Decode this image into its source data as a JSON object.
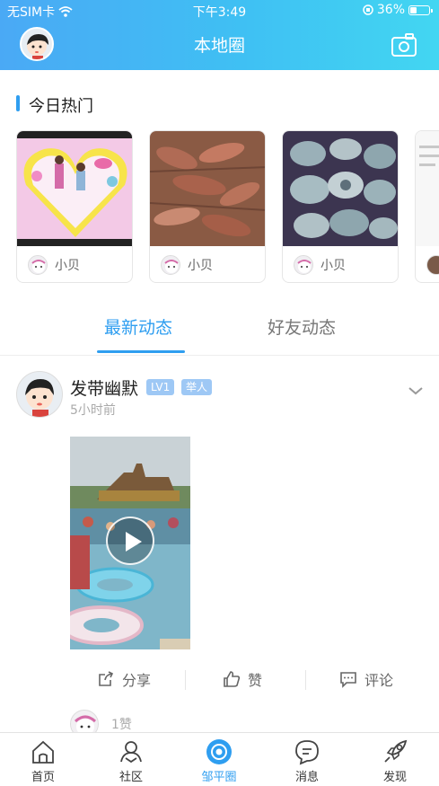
{
  "status_bar": {
    "carrier": "无SIM卡",
    "time": "下午3:49",
    "battery": "36%",
    "battery_level": 0.36
  },
  "nav": {
    "title": "本地圈",
    "avatar_icon": "user-avatar-icon",
    "camera_icon": "camera-icon"
  },
  "hot": {
    "title": "今日热门",
    "items": [
      {
        "author": "小贝",
        "image": "kids-heart-frame"
      },
      {
        "author": "小贝",
        "image": "crayfish"
      },
      {
        "author": "小贝",
        "image": "abalone"
      }
    ]
  },
  "tabs": [
    {
      "label": "最新动态",
      "active": true
    },
    {
      "label": "好友动态",
      "active": false
    }
  ],
  "post": {
    "username": "发带幽默",
    "level": "LV1",
    "role": "举人",
    "time": "5小时前",
    "video_thumbnail": "water-park-video",
    "actions": {
      "share": "分享",
      "like": "赞",
      "comment": "评论"
    },
    "like_count": "1赞"
  },
  "tabbar": [
    {
      "label": "首页",
      "icon": "home-icon",
      "active": false
    },
    {
      "label": "社区",
      "icon": "community-icon",
      "active": false
    },
    {
      "label": "邹平圈",
      "icon": "circle-camera-icon",
      "active": true
    },
    {
      "label": "消息",
      "icon": "message-icon",
      "active": false
    },
    {
      "label": "发现",
      "icon": "rocket-icon",
      "active": false
    }
  ],
  "colors": {
    "accent": "#2f9ef0",
    "header_start": "#4aa9f5",
    "header_end": "#42d6f2"
  }
}
